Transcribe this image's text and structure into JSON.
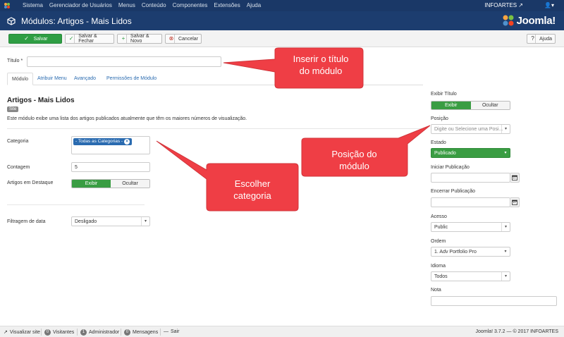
{
  "topbar": {
    "menu": [
      "Sistema",
      "Gerenciador de Usuários",
      "Menus",
      "Conteúdo",
      "Componentes",
      "Extensões",
      "Ajuda"
    ],
    "site_name": "INFOARTES",
    "user_icon": "user-icon"
  },
  "header": {
    "title": "Módulos: Artigos - Mais Lidos",
    "brand": "Joomla!"
  },
  "toolbar": {
    "save_label": "Salvar",
    "save_close_label": "Salvar & Fechar",
    "save_new_label": "Salvar & Novo",
    "cancel_label": "Cancelar",
    "help_label": "Ajuda"
  },
  "form": {
    "title_label": "Título *",
    "title_value": ""
  },
  "tabs": [
    "Módulo",
    "Atribuir Menu",
    "Avançado",
    "Permissões de Módulo"
  ],
  "module": {
    "heading": "Artigos - Mais Lidos",
    "badge": "Site",
    "description": "Este módulo exibe uma lista dos artigos publicados atualmente que têm os maiores números de visualização.",
    "categoria_label": "Categoria",
    "categoria_chip": "- Todas as Categorias -",
    "contagem_label": "Contagem",
    "contagem_value": "5",
    "destaque_label": "Artigos em Destaque",
    "destaque_on": "Exibir",
    "destaque_off": "Ocultar",
    "filtragem_label": "Filtragem de data",
    "filtragem_value": "Desligado"
  },
  "sidebar": {
    "exibir_titulo_label": "Exibir Título",
    "exibir_on": "Exibir",
    "exibir_off": "Ocultar",
    "posicao_label": "Posição",
    "posicao_placeholder": "Digite ou Selecione uma Posi...",
    "estado_label": "Estado",
    "estado_value": "Publicado",
    "iniciar_label": "Iniciar Publicação",
    "encerrar_label": "Encerrar Publicação",
    "acesso_label": "Acesso",
    "acesso_value": "Public",
    "ordem_label": "Ordem",
    "ordem_value": "1. Adv Portfolio Pro",
    "idioma_label": "Idioma",
    "idioma_value": "Todos",
    "nota_label": "Nota",
    "nota_value": ""
  },
  "callouts": {
    "titulo_line1": "Inserir o título",
    "titulo_line2": "do módulo",
    "posicao_line1": "Posição do",
    "posicao_line2": "módulo",
    "categoria_line1": "Escolher",
    "categoria_line2": "categoria"
  },
  "footer": {
    "visualizar": "Visualizar site",
    "visitantes_count": "0",
    "visitantes": "Visitantes",
    "admin_count": "1",
    "admin": "Administrador",
    "mensagens_count": "0",
    "mensagens": "Mensagens",
    "sair": "Sair",
    "version": "Joomla! 3.7.2 — © 2017 INFOARTES"
  },
  "colors": {
    "navbar": "#1a3867",
    "header": "#1c3d6f",
    "save_green": "#2f9e44",
    "callout_red": "#ef3e45",
    "link_blue": "#2a6bb0"
  }
}
